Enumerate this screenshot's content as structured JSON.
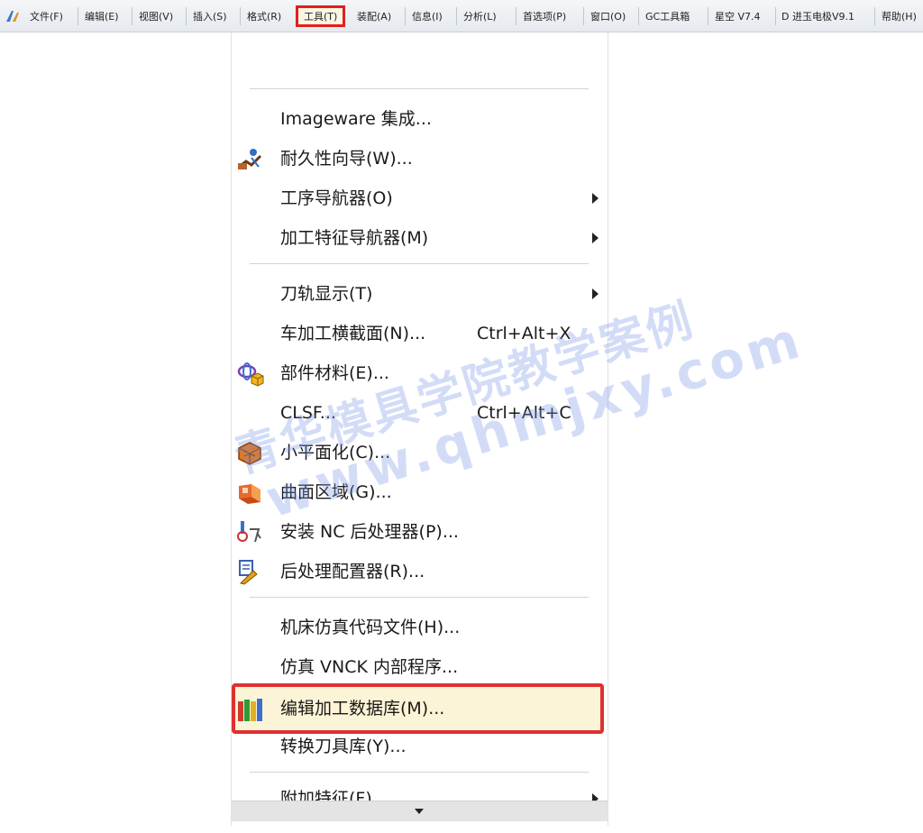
{
  "menubar": {
    "items": [
      {
        "label": "文件(F)"
      },
      {
        "label": "编辑(E)"
      },
      {
        "label": "视图(V)"
      },
      {
        "label": "插入(S)"
      },
      {
        "label": "格式(R)"
      },
      {
        "label": "工具(T)"
      },
      {
        "label": "装配(A)"
      },
      {
        "label": "信息(I)"
      },
      {
        "label": "分析(L)"
      },
      {
        "label": "首选项(P)"
      },
      {
        "label": "窗口(O)"
      },
      {
        "label": "GC工具箱"
      },
      {
        "label": "星空 V7.4"
      },
      {
        "label": "D 进玉电极V9.1"
      },
      {
        "label": "帮助(H)"
      }
    ],
    "active_item": "工具(T)",
    "highlight_color": "#e02020"
  },
  "dropdown": {
    "items": [
      {
        "label": "Imageware 集成..."
      },
      {
        "label": "耐久性向导(W)...",
        "icon": "durability-wizard-icon"
      },
      {
        "label": "工序导航器(O)",
        "submenu": true
      },
      {
        "label": "加工特征导航器(M)",
        "submenu": true
      },
      {
        "label": "刀轨显示(T)",
        "submenu": true
      },
      {
        "label": "车加工横截面(N)...",
        "shortcut": "Ctrl+Alt+X"
      },
      {
        "label": "部件材料(E)...",
        "icon": "part-material-icon"
      },
      {
        "label": "CLSF...",
        "shortcut": "Ctrl+Alt+C"
      },
      {
        "label": "小平面化(C)...",
        "icon": "facet-icon"
      },
      {
        "label": "曲面区域(G)...",
        "icon": "surface-region-icon"
      },
      {
        "label": "安装 NC 后处理器(P)...",
        "icon": "install-postprocessor-icon"
      },
      {
        "label": "后处理配置器(R)...",
        "icon": "post-configurator-icon"
      },
      {
        "label": "机床仿真代码文件(H)..."
      },
      {
        "label": "仿真 VNCK 内部程序..."
      },
      {
        "label": "编辑加工数据库(M)...",
        "icon": "machining-database-icon",
        "highlighted": true
      },
      {
        "label": "转换刀具库(Y)..."
      },
      {
        "label": "附加特征(F)",
        "submenu": true
      }
    ],
    "highlight_color": "#e03030",
    "highlight_background": "#fcf4d6"
  },
  "watermark": {
    "text_cn": "青华模具学院教学案例",
    "text_url": "www.qhmjxy.com"
  }
}
